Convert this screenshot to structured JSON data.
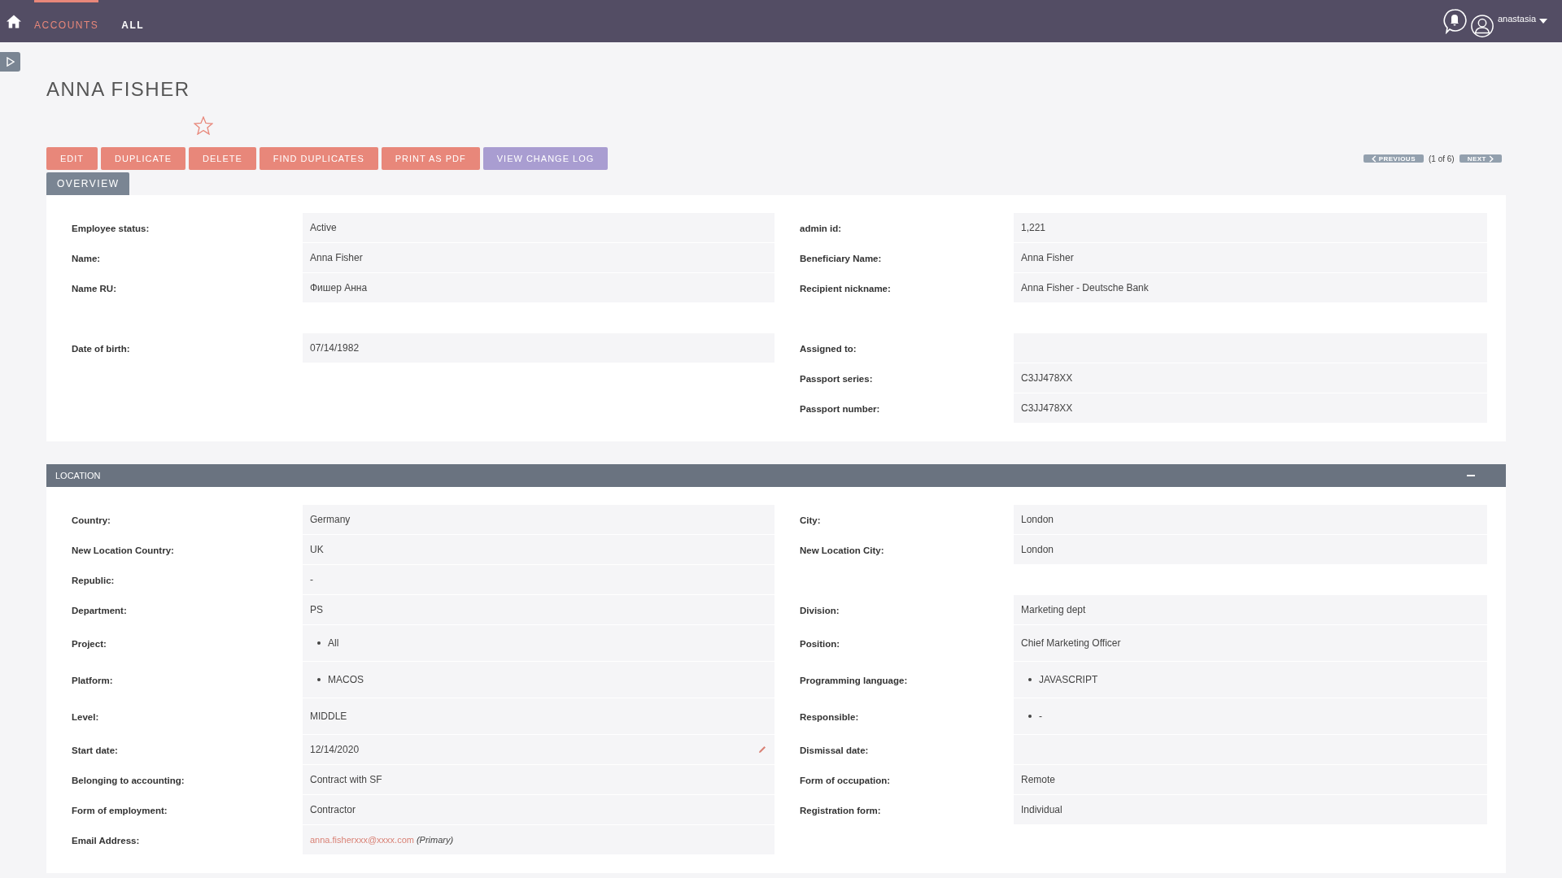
{
  "topbar": {
    "nav": [
      {
        "label": "ACCOUNTS",
        "selected": true
      },
      {
        "label": "ALL",
        "selected": false
      }
    ],
    "user": "anastasia"
  },
  "record": {
    "title": "ANNA FISHER",
    "favorite": false
  },
  "actions": [
    {
      "label": "EDIT",
      "kind": "primary"
    },
    {
      "label": "DUPLICATE",
      "kind": "primary"
    },
    {
      "label": "DELETE",
      "kind": "primary"
    },
    {
      "label": "FIND DUPLICATES",
      "kind": "primary"
    },
    {
      "label": "PRINT AS PDF",
      "kind": "primary"
    },
    {
      "label": "VIEW CHANGE LOG",
      "kind": "secondary"
    }
  ],
  "pager": {
    "previous": "PREVIOUS",
    "position": "(1 of 6)",
    "next": "NEXT"
  },
  "tabs": [
    {
      "label": "OVERVIEW",
      "selected": true
    }
  ],
  "overview": {
    "rows": [
      {
        "left": {
          "label": "Employee status:",
          "kind": "text",
          "value": "Active"
        },
        "right": {
          "label": "admin id:",
          "kind": "text",
          "value": "1,221"
        }
      },
      {
        "left": {
          "label": "Name:",
          "kind": "text",
          "value": "Anna Fisher"
        },
        "right": {
          "label": "Beneficiary Name:",
          "kind": "text",
          "value": "Anna Fisher"
        }
      },
      {
        "left": {
          "label": "Name RU:",
          "kind": "text",
          "value": "Фишер Анна"
        },
        "right": {
          "label": "Recipient nickname:",
          "kind": "text",
          "value": "Anna Fisher - Deutsche Bank"
        }
      },
      {},
      {
        "left": {
          "label": "Date of birth:",
          "kind": "text",
          "value": "07/14/1982"
        },
        "right": {
          "label": "Assigned to:",
          "kind": "text"
        }
      },
      {
        "right": {
          "label": "Passport series:",
          "kind": "text",
          "value": "C3JJ478XX"
        }
      },
      {
        "right": {
          "label": "Passport number:",
          "kind": "text",
          "value": "C3JJ478XX"
        }
      }
    ]
  },
  "location": {
    "title": "LOCATION",
    "collapsed": false,
    "rows": [
      {
        "left": {
          "label": "Country:",
          "kind": "text",
          "value": "Germany"
        },
        "right": {
          "label": "City:",
          "kind": "text",
          "value": "London"
        }
      },
      {
        "left": {
          "label": "New Location Country:",
          "kind": "text",
          "value": "UK"
        },
        "right": {
          "label": "New Location City:",
          "kind": "text",
          "value": "London"
        }
      },
      {
        "left": {
          "label": "Republic:",
          "kind": "text",
          "value": "-"
        }
      },
      {
        "left": {
          "label": "Department:",
          "kind": "text",
          "value": "PS"
        },
        "right": {
          "label": "Division:",
          "kind": "text",
          "value": "Marketing dept"
        }
      },
      {
        "left": {
          "label": "Project:",
          "kind": "list",
          "items": [
            "All"
          ]
        },
        "right": {
          "label": "Position:",
          "kind": "text",
          "value": "Chief Marketing Officer"
        }
      },
      {
        "left": {
          "label": "Platform:",
          "kind": "list",
          "items": [
            "MACOS"
          ]
        },
        "right": {
          "label": "Programming language:",
          "kind": "list",
          "items": [
            "JAVASCRIPT"
          ]
        }
      },
      {
        "left": {
          "label": "Level:",
          "kind": "text",
          "value": "MIDDLE"
        },
        "right": {
          "label": "Responsible:",
          "kind": "list",
          "items": [
            "-"
          ]
        }
      },
      {
        "left": {
          "label": "Start date:",
          "kind": "editable",
          "value": "12/14/2020"
        },
        "right": {
          "label": "Dismissal date:",
          "kind": "text"
        }
      },
      {
        "left": {
          "label": "Belonging to accounting:",
          "kind": "text",
          "value": "Contract with SF"
        },
        "right": {
          "label": "Form of occupation:",
          "kind": "text",
          "value": "Remote"
        }
      },
      {
        "left": {
          "label": "Form of employment:",
          "kind": "text",
          "value": "Contractor"
        },
        "right": {
          "label": "Registration form:",
          "kind": "text",
          "value": "Individual"
        }
      },
      {
        "left": {
          "label": "Email Address:",
          "kind": "email",
          "value": "anna.fisherxxx@xxxx.com",
          "note": "(Primary)"
        }
      }
    ]
  }
}
